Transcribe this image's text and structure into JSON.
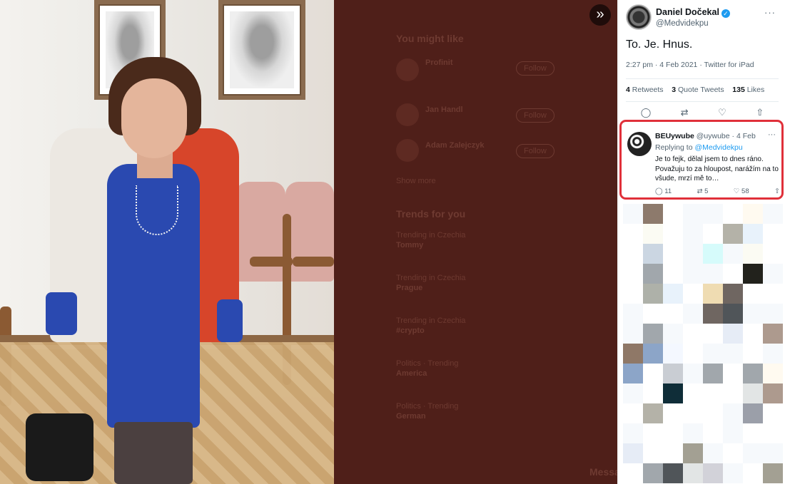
{
  "background": {
    "suggestions_title": "You might like",
    "suggestions": [
      {
        "name": "Profinit",
        "button": "Follow"
      },
      {
        "name": "Jan Handl",
        "button": "Follow"
      },
      {
        "name": "Adam Zalejczyk",
        "button": "Follow"
      }
    ],
    "show_more": "Show more",
    "trends_title": "Trends for you",
    "trends": [
      {
        "context": "Trending in Czechia",
        "topic": "Tommy"
      },
      {
        "context": "Trending in Czechia",
        "topic": "Prague"
      },
      {
        "context": "Trending in Czechia",
        "topic": "#crypto"
      },
      {
        "context": "Politics · Trending",
        "topic": "America"
      },
      {
        "context": "Politics · Trending",
        "topic": "German"
      }
    ],
    "messages_label": "Messages"
  },
  "tweet": {
    "author_name": "Daniel Dočekal",
    "author_handle": "@Medvidekpu",
    "text": "To. Je. Hnus.",
    "meta": "2:27 pm · 4 Feb 2021 · Twitter for iPad",
    "retweets": "4",
    "retweets_label": "Retweets",
    "quote_tweets": "3",
    "quote_tweets_label": "Quote Tweets",
    "likes": "135",
    "likes_label": "Likes"
  },
  "reply": {
    "name": "BEUywube",
    "handle_date": "@uywube · 4 Feb",
    "replying_label": "Replying to",
    "replying_to": "@Medvidekpu",
    "text": "Je to fejk, dělal jsem to dnes ráno. Považuju to za hloupost, narážím na to všude, mrzí mě to…",
    "replies": "11",
    "retweets": "5",
    "likes": "58"
  },
  "icons": {
    "expand": "»",
    "more": "···",
    "reply": "◯",
    "retweet": "⇄",
    "like": "♡",
    "share": "⇧"
  },
  "colors": {
    "highlight_border": "#e0303a",
    "link": "#1d9bf0",
    "overlay": "#4f1f19"
  }
}
